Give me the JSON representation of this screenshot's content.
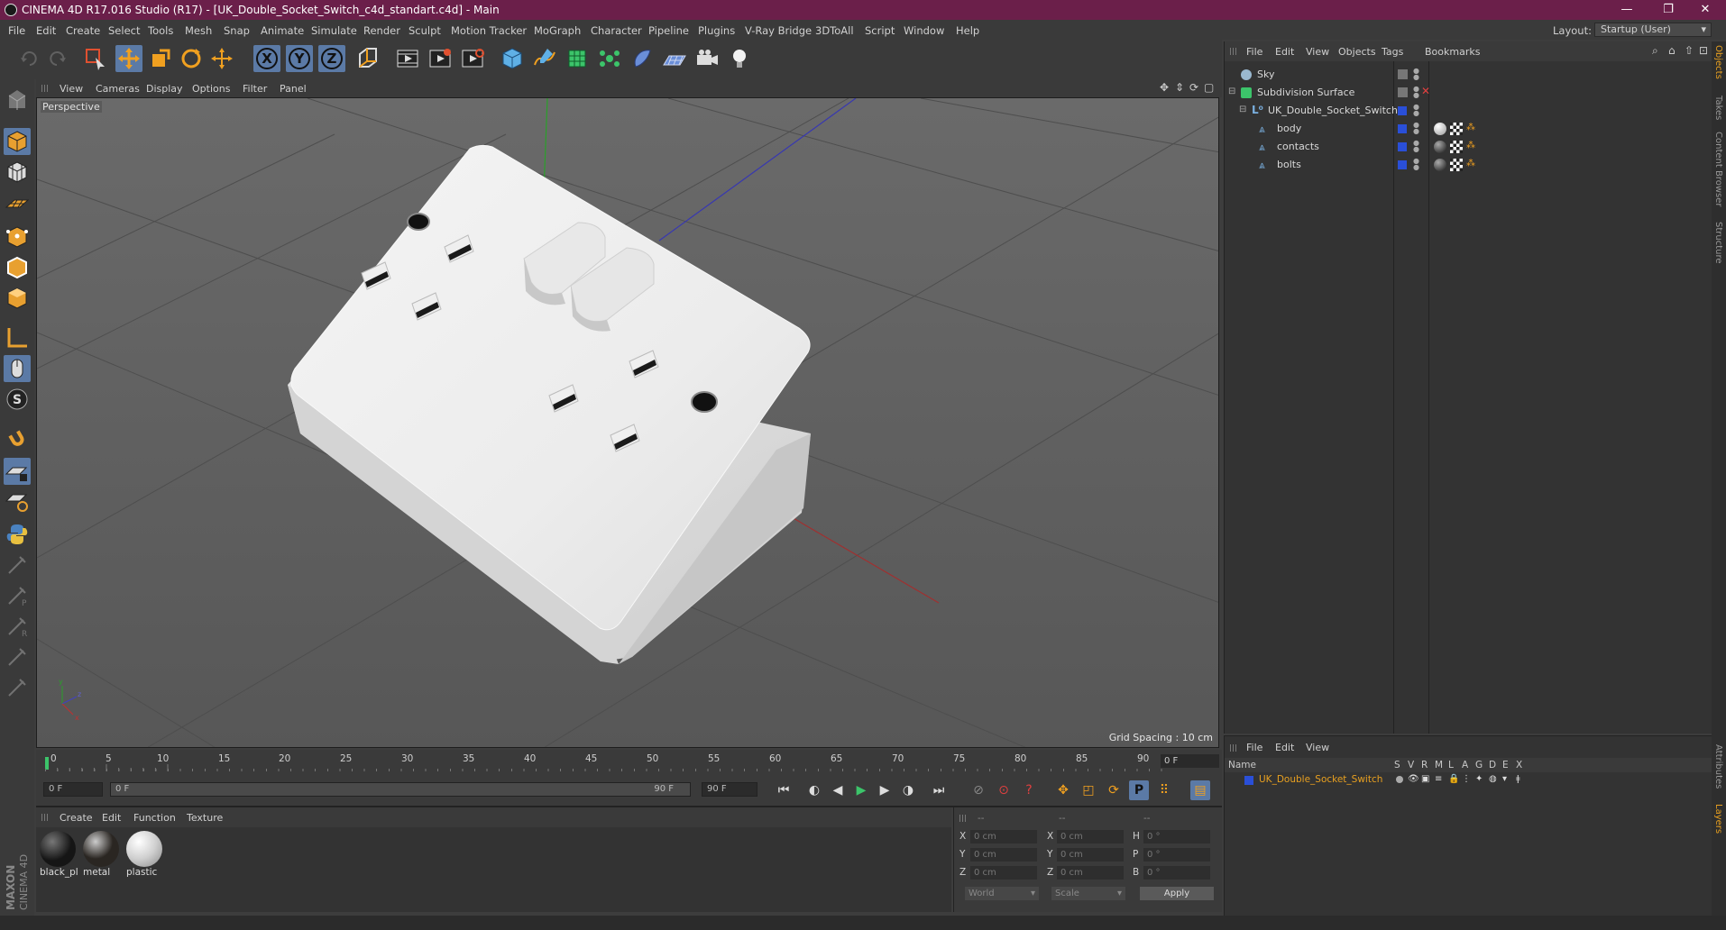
{
  "window": {
    "title": "CINEMA 4D R17.016 Studio (R17) - [UK_Double_Socket_Switch_c4d_standart.c4d] - Main",
    "controls": [
      "—",
      "❐",
      "✕"
    ]
  },
  "menubar": {
    "items": [
      "File",
      "Edit",
      "Create",
      "Select",
      "Tools",
      "Mesh",
      "Snap",
      "Animate",
      "Simulate",
      "Render",
      "Sculpt",
      "Motion Tracker",
      "MoGraph",
      "Character",
      "Pipeline",
      "Plugins",
      "V-Ray Bridge",
      "3DToAll",
      "Script",
      "Window",
      "Help"
    ],
    "layout_label": "Layout:",
    "layout_value": "Startup (User)"
  },
  "toolbar": {
    "axis_x": "X",
    "axis_y": "Y",
    "axis_z": "Z"
  },
  "viewport": {
    "menu": [
      "View",
      "Cameras",
      "Display",
      "Options",
      "Filter",
      "Panel"
    ],
    "label": "Perspective",
    "grid_spacing": "Grid Spacing : 10 cm"
  },
  "timeline": {
    "ticks": [
      "0",
      "5",
      "10",
      "15",
      "20",
      "25",
      "30",
      "35",
      "40",
      "45",
      "50",
      "55",
      "60",
      "65",
      "70",
      "75",
      "80",
      "85",
      "90"
    ],
    "current_frame": "0 F"
  },
  "playback": {
    "start": "0 F",
    "range_start": "0 F",
    "range_end": "90 F",
    "end": "90 F"
  },
  "materials": {
    "menu": [
      "Create",
      "Edit",
      "Function",
      "Texture"
    ],
    "items": [
      {
        "name": "black_pl",
        "color": "#151515"
      },
      {
        "name": "metal",
        "color": "#2a2622"
      },
      {
        "name": "plastic",
        "color": "#d8d8d8"
      }
    ]
  },
  "coordinates": {
    "header": [
      "--",
      "--",
      "--"
    ],
    "rows": [
      {
        "a": "X",
        "v1": "0 cm",
        "b": "X",
        "v2": "0 cm",
        "c": "H",
        "v3": "0 °"
      },
      {
        "a": "Y",
        "v1": "0 cm",
        "b": "Y",
        "v2": "0 cm",
        "c": "P",
        "v3": "0 °"
      },
      {
        "a": "Z",
        "v1": "0 cm",
        "b": "Z",
        "v2": "0 cm",
        "c": "B",
        "v3": "0 °"
      }
    ],
    "mode": "World",
    "scale": "Scale",
    "apply": "Apply"
  },
  "object_manager": {
    "menu": [
      "File",
      "Edit",
      "View",
      "Objects",
      "Tags",
      "Bookmarks"
    ],
    "objects": [
      {
        "name": "Sky"
      },
      {
        "name": "Subdivision Surface"
      },
      {
        "name": "UK_Double_Socket_Switch"
      },
      {
        "name": "body"
      },
      {
        "name": "contacts"
      },
      {
        "name": "bolts"
      }
    ]
  },
  "layer_manager": {
    "menu": [
      "File",
      "Edit",
      "View"
    ],
    "col_name": "Name",
    "cols": [
      "S",
      "V",
      "R",
      "M",
      "L",
      "A",
      "G",
      "D",
      "E",
      "X"
    ],
    "layer": "UK_Double_Socket_Switch"
  },
  "side_tabs": [
    "Objects",
    "Takes",
    "Content Browser",
    "Structure",
    "Attributes",
    "Layers"
  ],
  "brand": "MAXON CINEMA 4D",
  "colors": {
    "title_bar": "#6b1f4a",
    "active_tool": "#5b7aa6",
    "layer_highlight": "#e8a020",
    "layer_blue": "#2a4fd8"
  }
}
